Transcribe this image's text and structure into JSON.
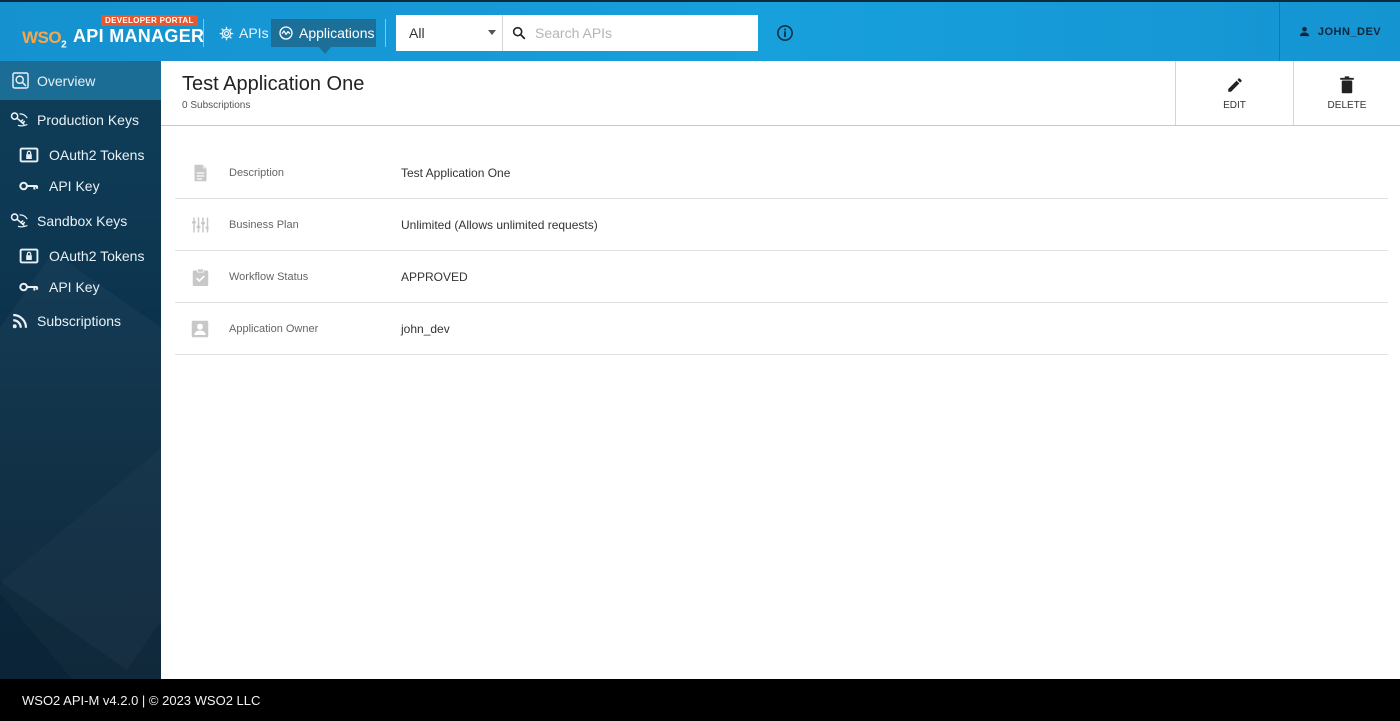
{
  "header": {
    "logo_badge": "DEVELOPER PORTAL",
    "logo_brand": "WSO",
    "logo_brand_sub": "2",
    "logo_product": "API MANAGER",
    "nav": {
      "apis": "APIs",
      "applications": "Applications"
    },
    "search": {
      "type": "All",
      "placeholder": "Search APIs"
    },
    "user": "JOHN_DEV"
  },
  "sidebar": {
    "items": [
      {
        "label": "Overview",
        "icon": "overview-search-icon",
        "active": true
      },
      {
        "label": "Production Keys",
        "icon": "keys-icon"
      },
      {
        "label": "OAuth2 Tokens",
        "icon": "lock-box-icon"
      },
      {
        "label": "API Key",
        "icon": "key-icon"
      },
      {
        "label": "Sandbox Keys",
        "icon": "keys-icon"
      },
      {
        "label": "OAuth2 Tokens",
        "icon": "lock-box-icon"
      },
      {
        "label": "API Key",
        "icon": "key-icon"
      },
      {
        "label": "Subscriptions",
        "icon": "rss-icon"
      }
    ]
  },
  "app": {
    "title": "Test Application One",
    "subscriptions": "0 Subscriptions",
    "actions": {
      "edit": "EDIT",
      "delete": "DELETE"
    },
    "details": [
      {
        "label": "Description",
        "value": "Test Application One",
        "icon": "description-icon"
      },
      {
        "label": "Business Plan",
        "value": "Unlimited (Allows unlimited requests)",
        "icon": "plan-sliders-icon"
      },
      {
        "label": "Workflow Status",
        "value": "APPROVED",
        "icon": "clipboard-check-icon"
      },
      {
        "label": "Application Owner",
        "value": "john_dev",
        "icon": "owner-icon"
      }
    ]
  },
  "footer": {
    "text": "WSO2 API-M v4.2.0 | © 2023 WSO2 LLC"
  },
  "colors": {
    "header": "#17a0dc",
    "sidebar": "#0d3550",
    "active_item": "#1c6d95",
    "badge": "#e8572e"
  }
}
